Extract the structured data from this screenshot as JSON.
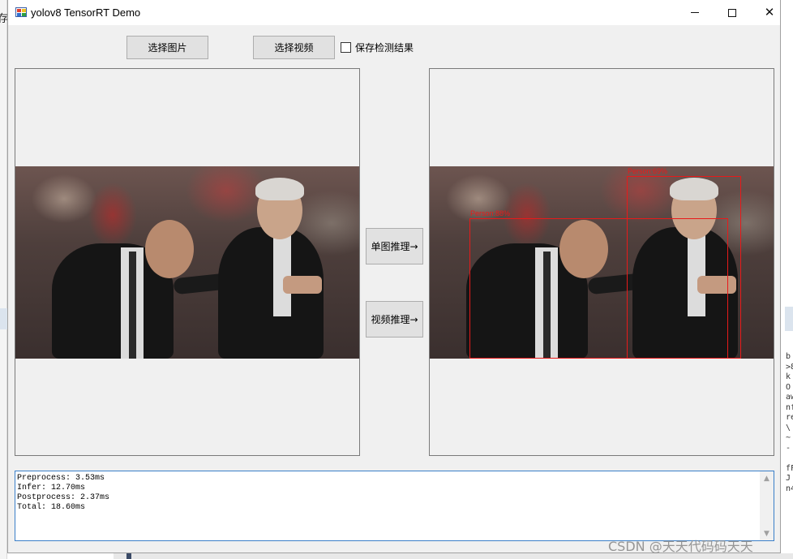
{
  "window": {
    "title": "yolov8 TensorRT Demo"
  },
  "toolbar": {
    "select_image_label": "选择图片",
    "select_video_label": "选择视频",
    "save_result_label": "保存检测结果",
    "save_result_checked": false
  },
  "actions": {
    "single_infer_label": "单图推理→",
    "video_infer_label": "视频推理→"
  },
  "detections": [
    {
      "label": "Person:69%"
    },
    {
      "label": "Person:88%"
    }
  ],
  "log": {
    "lines": [
      "Preprocess: 3.53ms",
      "Infer: 12.70ms",
      "Postprocess: 2.37ms",
      "Total: 18.60ms"
    ]
  },
  "background": {
    "left_glyph": "存",
    "right_chars": "b\n>8\nk\nO\naw\nnf\nre\n\\\n~\n-\n\nfF\nJ\nn4"
  },
  "watermark": "CSDN @天天代码码天天",
  "colors": {
    "window_bg": "#f0f0f0",
    "button_bg": "#e1e1e1",
    "detection_box": "#e81a1a",
    "log_border": "#3a7fc8"
  }
}
